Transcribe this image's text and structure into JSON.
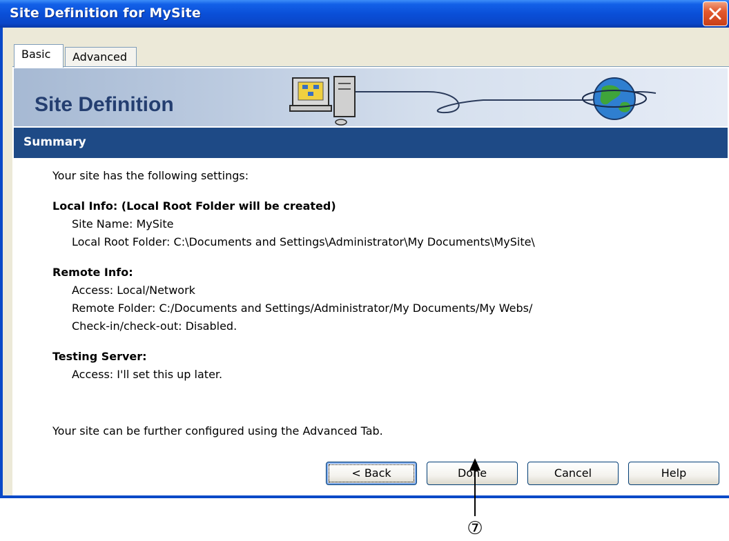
{
  "window": {
    "title": "Site Definition for MySite",
    "close_icon": "close-x-icon"
  },
  "tabs": [
    {
      "label": "Basic",
      "selected": true
    },
    {
      "label": "Advanced",
      "selected": false
    }
  ],
  "banner": {
    "title": "Site Definition",
    "art_icons": [
      "computer-icon",
      "globe-icon"
    ]
  },
  "section": {
    "title": "Summary"
  },
  "summary": {
    "intro": "Your site has the following settings:",
    "local": {
      "heading": "Local Info: (Local Root Folder will be created)",
      "site_name": "Site Name: MySite",
      "root_folder": "Local Root Folder: C:\\Documents and Settings\\Administrator\\My Documents\\MySite\\"
    },
    "remote": {
      "heading": "Remote Info:",
      "access": "Access: Local/Network",
      "folder": "Remote Folder: C:/Documents and Settings/Administrator/My Documents/My Webs/",
      "checkin": "Check-in/check-out: Disabled."
    },
    "testing": {
      "heading": "Testing Server:",
      "access": "Access: I'll set this up later."
    },
    "footer": "Your site can be further configured using the Advanced Tab."
  },
  "buttons": {
    "back": "< Back",
    "done": "Done",
    "cancel": "Cancel",
    "help": "Help"
  },
  "annotation": {
    "callout": "⑦"
  },
  "colors": {
    "titlebar": "#0a4fd8",
    "summary_bar": "#1e4a86",
    "banner_title": "#243e70",
    "close_button": "#e2582e"
  }
}
